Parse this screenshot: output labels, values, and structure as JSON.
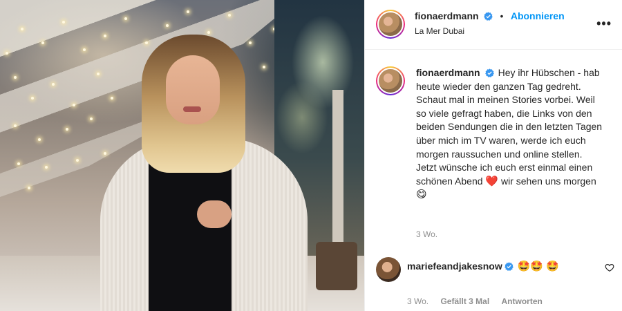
{
  "post": {
    "author": {
      "username": "fionaerdmann",
      "verified": true,
      "follow_label": "Abonnieren",
      "location": "La Mer Dubai"
    },
    "caption": {
      "username": "fionaerdmann",
      "text": "Hey ihr Hübschen - hab heute wieder den ganzen Tag gedreht. Schaut mal in meinen Stories vorbei. Weil so viele gefragt haben, die Links von den beiden Sendungen die in den letzten Tagen über mich im TV waren, werde ich euch morgen raussuchen und online stellen. Jetzt wünsche ich euch erst einmal einen schönen Abend",
      "heart": "❤️",
      "text_after_heart": "wir sehen uns morgen",
      "emoji_end": "😋",
      "time": "3 Wo."
    },
    "comments": [
      {
        "username": "mariefeandjakesnow",
        "verified": true,
        "text": "🤩🤩 🤩",
        "time": "3 Wo.",
        "likes": "Gefällt 3 Mal",
        "reply_label": "Antworten"
      }
    ]
  },
  "icons": {
    "more": "more-options-icon",
    "verified": "verified-badge-icon",
    "like": "heart-outline-icon"
  },
  "colors": {
    "follow_blue": "#0095f6",
    "verified_blue": "#3897f0",
    "meta_gray": "#8e8e8e"
  }
}
